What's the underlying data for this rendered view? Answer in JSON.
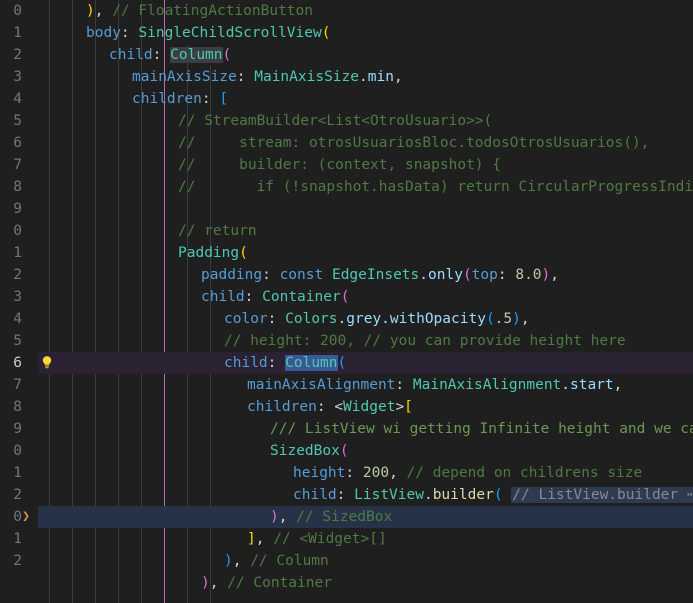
{
  "app": {
    "name": "code-editor",
    "theme": "dark-plus",
    "language": "Dart"
  },
  "colors": {
    "background": "#1f1f1f",
    "gutter_text": "#6e7681",
    "current_line_number": "#cccccc",
    "keyword": "#569cd6",
    "type": "#4ec9b0",
    "comment": "#4f7a43",
    "number": "#b5cea8",
    "property": "#9cdcfe",
    "bracket_level_1": "#ffd700",
    "bracket_level_2": "#da70d6",
    "bracket_level_3": "#179fff",
    "indent_guide": "#3b3b3b",
    "indent_guide_active": "#b66bb6",
    "highlight_line_purple": "#2a2133",
    "highlight_line_blue": "#263247",
    "selection_grey": "#3a3d41",
    "selection_blue": "#3a5a96",
    "folded_region": "#2d3a52",
    "lightbulb": "#fdd835"
  },
  "gutter": {
    "line_numbers": [
      "0",
      "1",
      "2",
      "3",
      "4",
      "5",
      "6",
      "7",
      "8",
      "9",
      "0",
      "1",
      "2",
      "3",
      "4",
      "5",
      "6",
      "7",
      "8",
      "9",
      "0",
      "1",
      "2",
      "0",
      "1",
      "2",
      ""
    ],
    "fold_chevron_line_index": 22,
    "fold_chevron_glyph": "❯",
    "lightbulb_line_index": 15,
    "lightbulb_icon": "lightbulb-icon"
  },
  "editor": {
    "line_height": 22,
    "current_line_index": 22,
    "folded_ellipsis": "⋯",
    "lines": [
      {
        "index": 0,
        "text": "       ), // FloatingActionButton"
      },
      {
        "index": 1,
        "text": "       body: SingleChildScrollView("
      },
      {
        "index": 2,
        "text": "         child: Column("
      },
      {
        "index": 3,
        "text": "           mainAxisSize: MainAxisSize.min,"
      },
      {
        "index": 4,
        "text": "           children: ["
      },
      {
        "index": 5,
        "text": "             // StreamBuilder<List<OtroUsuario>>("
      },
      {
        "index": 6,
        "text": "             //     stream: otrosUsuariosBloc.todosOtrosUsuarios(),"
      },
      {
        "index": 7,
        "text": "             //     builder: (context, snapshot) {"
      },
      {
        "index": 8,
        "text": "             //       if (!snapshot.hasData) return CircularProgressIndi"
      },
      {
        "index": 9,
        "text": ""
      },
      {
        "index": 10,
        "text": "             // return"
      },
      {
        "index": 11,
        "text": "             Padding("
      },
      {
        "index": 12,
        "text": "               padding: const EdgeInsets.only(top: 8.0),"
      },
      {
        "index": 13,
        "text": "               child: Container("
      },
      {
        "index": 14,
        "text": "                 color: Colors.grey.withOpacity(.5),"
      },
      {
        "index": 15,
        "text": "                 // height: 200, // you can provide height here"
      },
      {
        "index": 16,
        "text": "                 child: Column("
      },
      {
        "index": 17,
        "text": "                   mainAxisAlignment: MainAxisAlignment.start,"
      },
      {
        "index": 18,
        "text": "                   children: <Widget>["
      },
      {
        "index": 19,
        "text": "                     /// ListView wi getting Infinite height and we cant"
      },
      {
        "index": 20,
        "text": "                     SizedBox("
      },
      {
        "index": 21,
        "text": "                       height: 200, // depend on childrens size"
      },
      {
        "index": 22,
        "text": "                       child: ListView.builder( // ListView.builder ⋯"
      },
      {
        "index": 23,
        "text": "                     ), // SizedBox"
      },
      {
        "index": 24,
        "text": "                   ], // <Widget>[]"
      },
      {
        "index": 25,
        "text": "                 ), // Column"
      },
      {
        "index": 26,
        "text": "               ), // Container"
      }
    ]
  },
  "selections": [
    {
      "line_index": 2,
      "token": "Column",
      "style": "grey"
    },
    {
      "line_index": 16,
      "token": "Column",
      "style": "blue"
    }
  ],
  "folded_regions": [
    {
      "line_index": 22,
      "label": "// ListView.builder",
      "ellipsis": "⋯"
    }
  ]
}
